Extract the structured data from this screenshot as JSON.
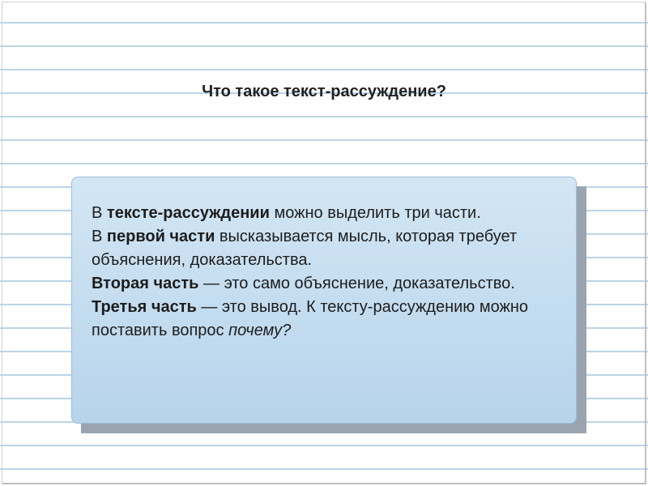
{
  "title": "Что такое текст-рассуждение?",
  "body": {
    "p1a": "В ",
    "p1b": "тексте-рассуждении",
    "p1c": " можно выделить три части.",
    "p2a": "В ",
    "p2b": "первой части",
    "p2c": " высказывается мысль, которая требует объяснения, доказательства.",
    "p3a": "Вторая часть",
    "p3b": " — это само объяснение, доказательство.",
    "p4a": "Третья часть",
    "p4b": " — это вывод. К тексту-рассуждению можно поставить вопрос ",
    "p4c": "почему?"
  }
}
